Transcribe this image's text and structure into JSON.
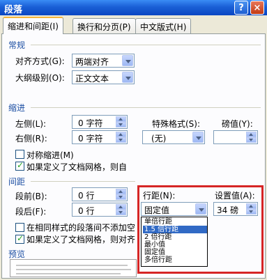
{
  "window": {
    "title": "段落",
    "help": "?",
    "close": "×"
  },
  "tabs": [
    {
      "label": "缩进和间距(I)"
    },
    {
      "label": "换行和分页(P)"
    },
    {
      "label": "中文版式(H)"
    }
  ],
  "general": {
    "title": "常规",
    "alignment_label": "对齐方式(G):",
    "alignment_value": "两端对齐",
    "outline_label": "大纲级别(O):",
    "outline_value": "正文文本"
  },
  "indent": {
    "title": "缩进",
    "left_label": "左侧(L):",
    "left_value": "0 字符",
    "right_label": "右侧(R):",
    "right_value": "0 字符",
    "special_label": "特殊格式(S):",
    "special_value": "(无)",
    "by_label": "磅值(Y):",
    "mirror_label": "对称缩进(M)",
    "mirror_checked": false,
    "grid_label": "如果定义了文档网格，则自",
    "grid_checked": true
  },
  "spacing": {
    "title": "间距",
    "before_label": "段前(B):",
    "before_value": "0 行",
    "after_label": "段后(F):",
    "after_value": "0 行",
    "line_label": "行距(N):",
    "line_value": "固定值",
    "at_label": "设置值(A):",
    "at_value": "34 磅",
    "same_style_label": "在相同样式的段落间不添加空",
    "same_style_checked": false,
    "snap_label": "如果定义了文档网格，则对齐",
    "snap_checked": true,
    "line_options": [
      "单倍行距",
      "1.5 倍行距",
      "2 倍行距",
      "最小值",
      "固定值",
      "多倍行距"
    ],
    "line_options_selected": 1
  },
  "preview": {
    "title": "预览"
  },
  "colors": {
    "highlight": "#316ac5",
    "annotation": "#d62525",
    "section": "#1d4fa3"
  }
}
